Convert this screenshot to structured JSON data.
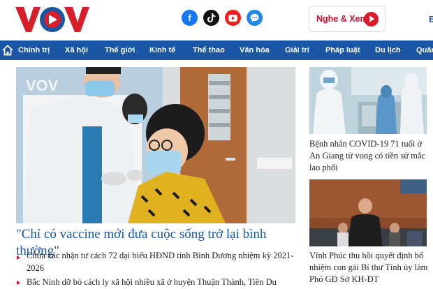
{
  "header": {
    "logo_text": "VOV",
    "social_icons": [
      "facebook-icon",
      "tiktok-icon",
      "youtube-icon",
      "messenger-icon"
    ],
    "watch_button_label": "Nghe & Xem",
    "edge_letter": "E"
  },
  "nav": {
    "items": [
      {
        "label": "Chính trị"
      },
      {
        "label": "Xã hội"
      },
      {
        "label": "Thế giới"
      },
      {
        "label": "Kinh tế"
      },
      {
        "label": "Thể thao"
      },
      {
        "label": "Văn hóa"
      },
      {
        "label": "Giải trí"
      },
      {
        "label": "Pháp luật"
      },
      {
        "label": "Du lịch"
      },
      {
        "label": "Quân"
      }
    ]
  },
  "main": {
    "hero_watermark": "VOV",
    "hero_title": "\"Chỉ có vaccine mới đưa cuộc sống trở lại bình thường\"",
    "related": [
      {
        "text": "Chưa xác nhận tư cách 72 đại biểu HĐND tỉnh Bình Dương nhiệm kỳ 2021-2026"
      },
      {
        "text": "Bắc Ninh dỡ bỏ cách ly xã hội nhiều xã ở huyện Thuận Thành, Tiên Du"
      }
    ]
  },
  "sidebar": {
    "articles": [
      {
        "title": "Bệnh nhân COVID-19 71 tuổi ở An Giang tử vong có tiền sử mắc lao phổi"
      },
      {
        "title": "Vĩnh Phúc thu hồi quyết định bổ nhiệm con gái Bí thư Tỉnh ủy làm Phó GĐ Sở KH-ĐT"
      }
    ]
  },
  "colors": {
    "brand_red": "#c8102e",
    "nav_blue": "#1a56a3",
    "title_blue": "#1a56a3"
  }
}
